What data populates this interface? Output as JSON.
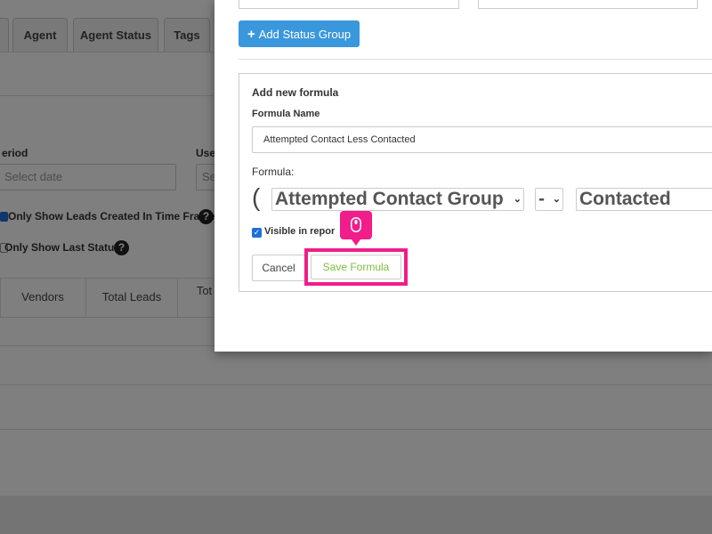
{
  "tabs": [
    {
      "label": ""
    },
    {
      "label": "Agent"
    },
    {
      "label": "Agent Status"
    },
    {
      "label": "Tags"
    },
    {
      "label": ""
    }
  ],
  "filters": {
    "period_label": "eriod",
    "date_placeholder": "Select date",
    "user_label": "Use",
    "user_value": "Se",
    "only_created_label": "Only Show Leads Created In Time Frame",
    "only_last_status_label": "Only Show Last Status"
  },
  "table": {
    "headers": [
      "",
      "Vendors",
      "Total Leads",
      "Tot"
    ]
  },
  "modal": {
    "add_status_group_label": "Add Status Group",
    "add_formula_title": "Add new formula",
    "formula_name_label": "Formula Name",
    "formula_name_value": "Attempted Contact Less Contacted",
    "formula_label": "Formula:",
    "open_paren": "(",
    "left_operand": "Attempted Contact Group",
    "operator": "-",
    "right_operand": "Contacted",
    "visible_in_report_label": "Visible in repor",
    "visible_in_report_checked": true,
    "cancel_label": "Cancel",
    "save_label": "Save Formula"
  },
  "colors": {
    "primary": "#3a97dc",
    "save_text": "#7cbf3b",
    "highlight": "#f01d8a"
  },
  "icons": {
    "plus": "plus-icon",
    "help": "help-icon",
    "mouse": "mouse-icon",
    "chevron": "chevron-down-icon"
  }
}
